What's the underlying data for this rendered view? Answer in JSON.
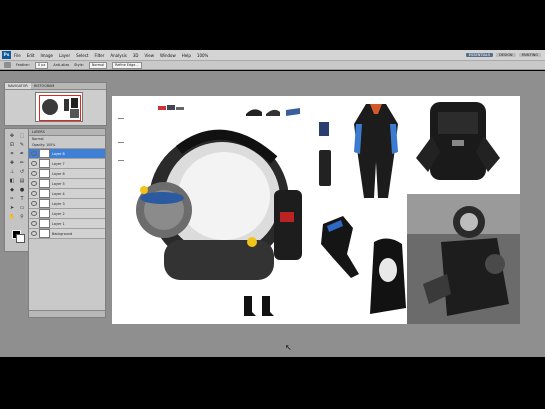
{
  "menubar": {
    "logo": "Ps",
    "items": [
      "File",
      "Edit",
      "Image",
      "Layer",
      "Select",
      "Filter",
      "Analysis",
      "3D",
      "View",
      "Window",
      "Help"
    ],
    "zoom": "100%",
    "right": [
      "ESSENTIALS",
      "DESIGN",
      "PAINTING"
    ]
  },
  "options": {
    "feather_label": "Feather:",
    "feather_value": "0 px",
    "antialias_label": "Anti-alias",
    "style_label": "Style:",
    "style_value": "Normal",
    "refine_label": "Refine Edge..."
  },
  "navigator": {
    "tabs": [
      "NAVIGATOR",
      "HISTOGRAM"
    ]
  },
  "layers_panel": {
    "title": "LAYERS",
    "blend_mode": "Normal",
    "opacity_label": "Opacity: 100%",
    "fill_label": "Fill: 100%",
    "layers": [
      "Layer 8",
      "Layer 7",
      "Layer 6",
      "Layer 5",
      "Layer 4",
      "Layer 3",
      "Layer 2",
      "Layer 1",
      "Background"
    ],
    "selected": 0
  },
  "canvas": {
    "annotation_top": "—— ——"
  },
  "colors": {
    "selected_layer": "#3f7fd6",
    "menubar_bg": "#d4d4d4",
    "workspace_bg": "#8f8f8f",
    "navigator_frame": "#e0261d"
  }
}
